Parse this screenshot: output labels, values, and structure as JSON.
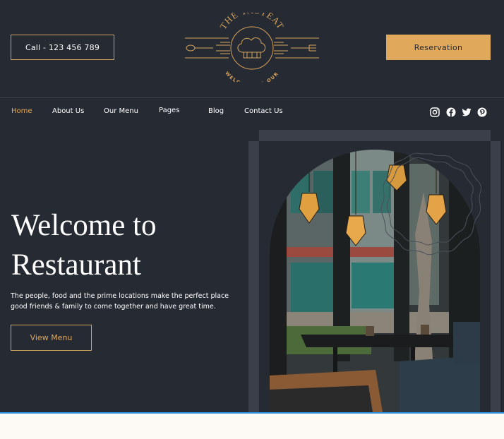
{
  "header": {
    "call_label": "Call - 123 456 789",
    "reservation_label": "Reservation",
    "logo": {
      "name": "THE TASTEAT",
      "tagline": "WELCOME TO OUR"
    }
  },
  "nav": {
    "items": [
      {
        "label": "Home",
        "active": true
      },
      {
        "label": "About Us",
        "active": false
      },
      {
        "label": "Our Menu",
        "active": false
      },
      {
        "label": "Pages",
        "active": false
      },
      {
        "label": "Blog",
        "active": false
      },
      {
        "label": "Contact Us",
        "active": false
      }
    ],
    "social": [
      "instagram-icon",
      "facebook-icon",
      "twitter-icon",
      "pinterest-icon"
    ]
  },
  "hero": {
    "title_line1": "Welcome to",
    "title_line2": "Restaurant",
    "description": "The people, food and the prime locations make the perfect place good friends & family to come together and have great time.",
    "button_label": "View Menu"
  },
  "colors": {
    "background": "#262a33",
    "accent": "#e0a85a",
    "text": "#ffffff",
    "panel": "#3a3f49",
    "footer_strip": "#fdf9f5",
    "bottom_line": "#2f8fd8"
  }
}
